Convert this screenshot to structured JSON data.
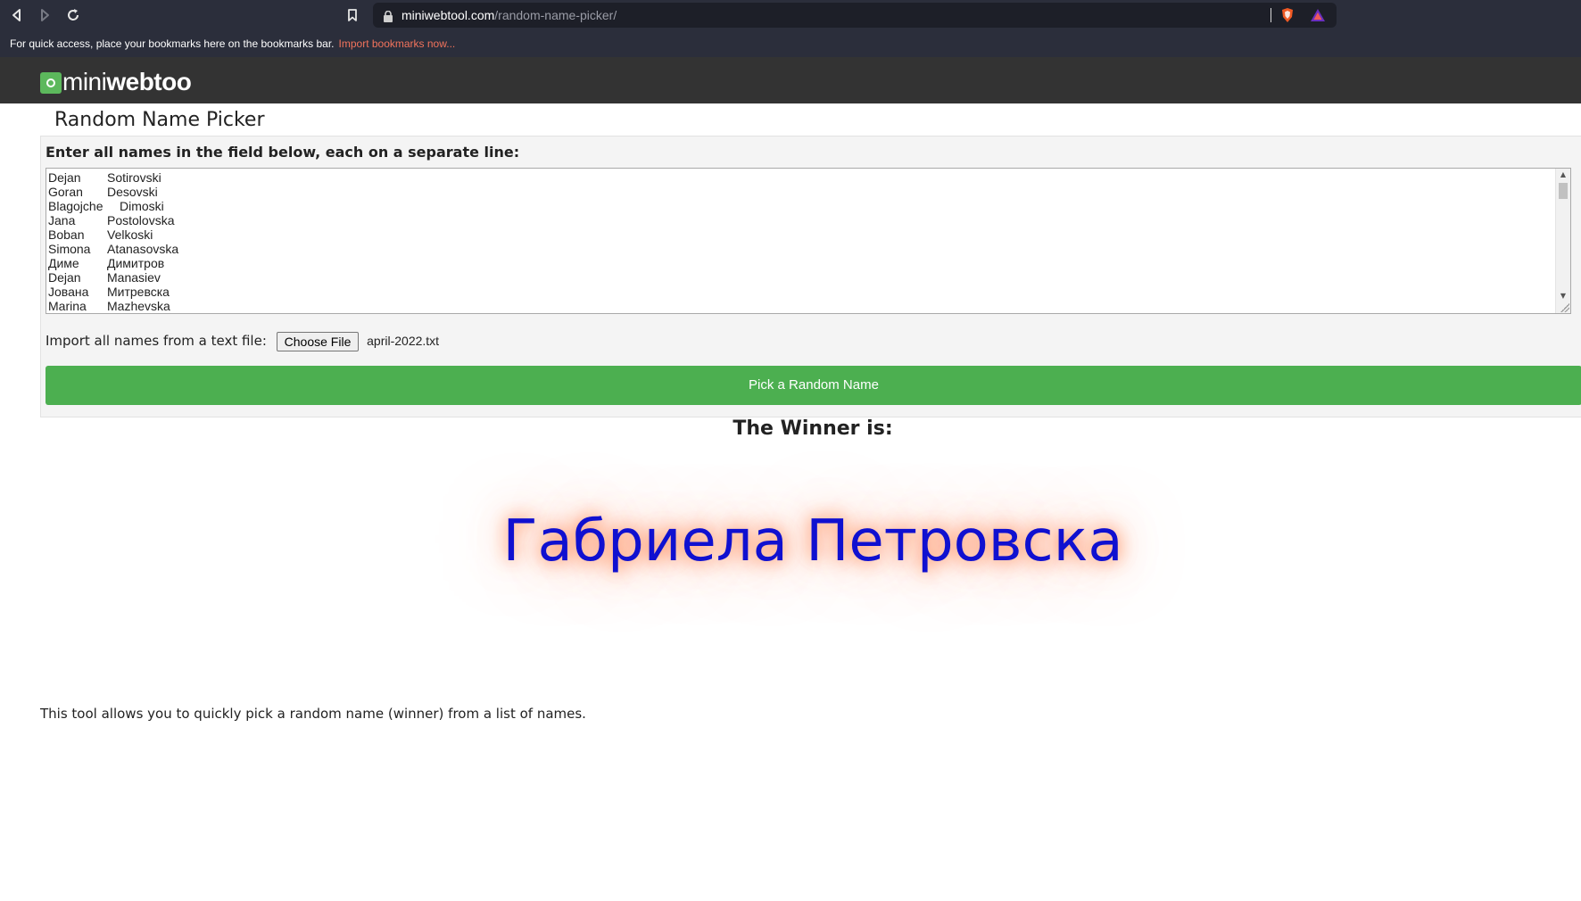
{
  "browser": {
    "url_domain": "miniwebtool.com",
    "url_path": "/random-name-picker/",
    "bookmarks_message": "For quick access, place your bookmarks here on the bookmarks bar.",
    "bookmarks_link": "Import bookmarks now..."
  },
  "site": {
    "logo_light": "mini",
    "logo_bold": "webtool"
  },
  "page": {
    "title": "Random Name Picker",
    "instructions": "Enter all names in the field below, each on a separate line:",
    "names": [
      {
        "first": "Dejan",
        "last": "Sotirovski"
      },
      {
        "first": "Goran",
        "last": "Desovski"
      },
      {
        "first": "Blagojche",
        "last": "Dimoski"
      },
      {
        "first": "Jana",
        "last": "Postolovska"
      },
      {
        "first": "Boban",
        "last": "Velkoski"
      },
      {
        "first": "Simona",
        "last": "Atanasovska"
      },
      {
        "first": "Диме",
        "last": "Димитров"
      },
      {
        "first": "Dejan",
        "last": "Manasiev"
      },
      {
        "first": "Јована",
        "last": "Митревска"
      },
      {
        "first": "Marina",
        "last": "Mazhevska"
      }
    ],
    "import_label": "Import all names from a text file:",
    "choose_file_label": "Choose File",
    "selected_file": "april-2022.txt",
    "pick_button_label": "Pick a Random Name",
    "winner_label": "The Winner is:",
    "winner_name": "Габриела Петровска",
    "description": "This tool allows you to quickly pick a random name (winner) from a list of names."
  }
}
